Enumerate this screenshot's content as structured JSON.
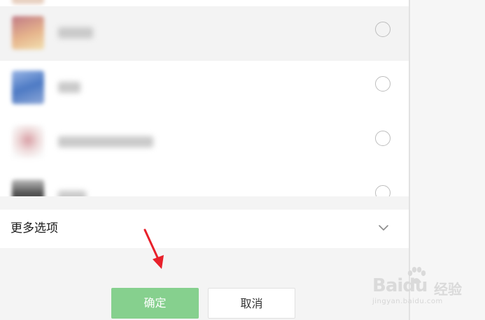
{
  "app_list": {
    "items": [
      {
        "name": "",
        "icon": "app-thumbnail-icon",
        "selected": true,
        "thumb_color": "#d08a8a"
      },
      {
        "name": "",
        "icon": "app-thumbnail-icon",
        "selected": false,
        "thumb_color": "#5e86c8"
      },
      {
        "name": "",
        "icon": "app-thumbnail-icon",
        "selected": false,
        "thumb_color": "#e8c8c8"
      },
      {
        "name": "",
        "icon": "app-thumbnail-icon",
        "selected": false,
        "thumb_color": "#6a6a6a"
      }
    ]
  },
  "more_options": {
    "label": "更多选项",
    "icon": "chevron-down-icon"
  },
  "actions": {
    "confirm_label": "确定",
    "cancel_label": "取消"
  },
  "annotation": {
    "icon": "red-arrow-icon",
    "color": "#e8202a"
  },
  "watermark": {
    "brand": "Baidu",
    "product": "经验",
    "url": "jingyan.baidu.com"
  },
  "colors": {
    "confirm_button": "#86d08e",
    "selected_row": "#f3f3f3",
    "page_background": "#f4f4f4"
  }
}
